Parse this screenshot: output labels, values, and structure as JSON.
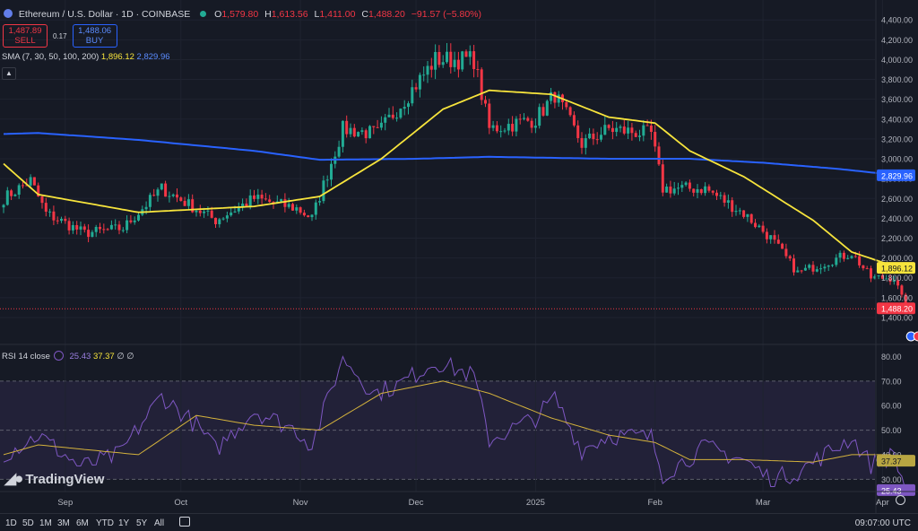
{
  "header": {
    "symbol": "Ethereum / U.S. Dollar · 1D · COINBASE",
    "o_label": "O",
    "o_value": "1,579.80",
    "h_label": "H",
    "h_value": "1,613.56",
    "l_label": "L",
    "l_value": "1,411.00",
    "c_label": "C",
    "c_value": "1,488.20",
    "change": "−91.57 (−5.80%)"
  },
  "trade": {
    "sell_price": "1,487.89",
    "sell_label": "SELL",
    "spread": "0.17",
    "buy_price": "1,488.06",
    "buy_label": "BUY"
  },
  "sma_legend": {
    "label": "SMA (7, 30, 50, 100, 200)",
    "v1": "1,896.12",
    "v2": "2,829.96"
  },
  "rsi_legend": {
    "label": "RSI 14 close",
    "v1": "25.43",
    "v2": "37.37",
    "v3": "∅",
    "v4": "∅"
  },
  "branding": {
    "logo_text": "TradingView"
  },
  "bottom_bar": {
    "timeframes": [
      "1D",
      "5D",
      "1M",
      "3M",
      "6M",
      "YTD",
      "1Y",
      "5Y",
      "All"
    ],
    "clock": "09:07:00 UTC"
  },
  "colors": {
    "background": "#161a25",
    "up": "#22ab94",
    "down": "#f23645",
    "sma_fast": "#f7e43c",
    "sma_slow": "#2962ff",
    "rsi": "#7e57c2",
    "rsi_ma": "#d4b23c"
  },
  "chart_data": [
    {
      "type": "candlestick",
      "title": "Ethereum / U.S. Dollar · 1D · COINBASE",
      "x_labels": [
        "Sep",
        "Oct",
        "Nov",
        "Dec",
        "2025",
        "Feb",
        "Mar",
        "Apr"
      ],
      "y_ticks": [
        "1,400.00",
        "1,600.00",
        "1,800.00",
        "2,000.00",
        "2,200.00",
        "2,400.00",
        "2,600.00",
        "2,800.00",
        "3,000.00",
        "3,200.00",
        "3,400.00",
        "3,600.00",
        "3,800.00",
        "4,000.00",
        "4,200.00",
        "4,400.00"
      ],
      "ylim": [
        1300,
        4420
      ],
      "close_anchors": [
        [
          "2024-08-16",
          2600
        ],
        [
          "2024-08-23",
          2780
        ],
        [
          "2024-08-27",
          2450
        ],
        [
          "2024-09-06",
          2250
        ],
        [
          "2024-09-16",
          2300
        ],
        [
          "2024-09-26",
          2700
        ],
        [
          "2024-10-10",
          2380
        ],
        [
          "2024-10-20",
          2600
        ],
        [
          "2024-10-31",
          2500
        ],
        [
          "2024-11-04",
          2400
        ],
        [
          "2024-11-12",
          3300
        ],
        [
          "2024-11-21",
          3250
        ],
        [
          "2024-11-26",
          3500
        ],
        [
          "2024-12-06",
          4000
        ],
        [
          "2024-12-16",
          4000
        ],
        [
          "2024-12-20",
          3300
        ],
        [
          "2025-01-01",
          3400
        ],
        [
          "2025-01-06",
          3650
        ],
        [
          "2025-01-13",
          3150
        ],
        [
          "2025-01-20",
          3300
        ],
        [
          "2025-01-31",
          3250
        ],
        [
          "2025-02-03",
          2700
        ],
        [
          "2025-02-14",
          2700
        ],
        [
          "2025-02-24",
          2450
        ],
        [
          "2025-03-03",
          2200
        ],
        [
          "2025-03-10",
          1850
        ],
        [
          "2025-03-24",
          2050
        ],
        [
          "2025-03-29",
          1800
        ],
        [
          "2025-04-04",
          1800
        ],
        [
          "2025-04-07",
          1488.2
        ]
      ],
      "sma_7": [
        [
          "2024-08-16",
          2950
        ],
        [
          "2024-08-25",
          2640
        ],
        [
          "2024-09-20",
          2460
        ],
        [
          "2024-10-05",
          2490
        ],
        [
          "2024-10-20",
          2520
        ],
        [
          "2024-11-06",
          2620
        ],
        [
          "2024-11-22",
          3000
        ],
        [
          "2024-12-08",
          3500
        ],
        [
          "2024-12-20",
          3690
        ],
        [
          "2025-01-05",
          3650
        ],
        [
          "2025-01-20",
          3420
        ],
        [
          "2025-02-01",
          3360
        ],
        [
          "2025-02-10",
          3080
        ],
        [
          "2025-02-24",
          2820
        ],
        [
          "2025-03-14",
          2380
        ],
        [
          "2025-03-24",
          2060
        ],
        [
          "2025-04-03",
          1930
        ],
        [
          "2025-04-06",
          1896.12
        ]
      ],
      "sma_200": [
        [
          "2024-08-16",
          3250
        ],
        [
          "2024-08-25",
          3260
        ],
        [
          "2024-09-20",
          3190
        ],
        [
          "2024-10-20",
          3080
        ],
        [
          "2024-11-06",
          2990
        ],
        [
          "2024-12-01",
          3000
        ],
        [
          "2024-12-20",
          3020
        ],
        [
          "2025-01-20",
          3000
        ],
        [
          "2025-02-10",
          3000
        ],
        [
          "2025-03-01",
          2960
        ],
        [
          "2025-03-20",
          2900
        ],
        [
          "2025-04-06",
          2829.96
        ]
      ],
      "last_price": 1488.2,
      "sma_7_last": 1896.12,
      "sma_200_last": 2829.96
    },
    {
      "type": "line",
      "title": "RSI 14 close",
      "y_ticks": [
        "30.00",
        "40.00",
        "50.00",
        "60.00",
        "70.00",
        "80.00"
      ],
      "levels": [
        70,
        50,
        30
      ],
      "ylim": [
        25,
        82
      ],
      "rsi_anchors": [
        [
          "2024-08-16",
          40
        ],
        [
          "2024-08-25",
          48
        ],
        [
          "2024-09-05",
          35
        ],
        [
          "2024-09-15",
          40
        ],
        [
          "2024-09-26",
          64
        ],
        [
          "2024-10-05",
          52
        ],
        [
          "2024-10-10",
          42
        ],
        [
          "2024-10-20",
          58
        ],
        [
          "2024-10-31",
          50
        ],
        [
          "2024-11-04",
          44
        ],
        [
          "2024-11-12",
          80
        ],
        [
          "2024-11-20",
          65
        ],
        [
          "2024-11-26",
          68
        ],
        [
          "2024-12-06",
          78
        ],
        [
          "2024-12-16",
          72
        ],
        [
          "2024-12-20",
          46
        ],
        [
          "2025-01-01",
          55
        ],
        [
          "2025-01-06",
          63
        ],
        [
          "2025-01-13",
          42
        ],
        [
          "2025-01-20",
          48
        ],
        [
          "2025-01-31",
          47
        ],
        [
          "2025-02-03",
          32
        ],
        [
          "2025-02-14",
          43
        ],
        [
          "2025-02-24",
          38
        ],
        [
          "2025-03-03",
          30
        ],
        [
          "2025-03-10",
          33
        ],
        [
          "2025-03-24",
          47
        ],
        [
          "2025-03-29",
          36
        ],
        [
          "2025-04-04",
          40
        ],
        [
          "2025-04-07",
          25.43
        ]
      ],
      "rsi_ma_anchors": [
        [
          "2024-08-16",
          40
        ],
        [
          "2024-08-25",
          44
        ],
        [
          "2024-09-20",
          40
        ],
        [
          "2024-10-05",
          56
        ],
        [
          "2024-10-20",
          52
        ],
        [
          "2024-11-06",
          50
        ],
        [
          "2024-11-22",
          65
        ],
        [
          "2024-12-08",
          70
        ],
        [
          "2024-12-20",
          65
        ],
        [
          "2025-01-05",
          55
        ],
        [
          "2025-01-20",
          48
        ],
        [
          "2025-02-01",
          45
        ],
        [
          "2025-02-10",
          38
        ],
        [
          "2025-02-24",
          38
        ],
        [
          "2025-03-14",
          37
        ],
        [
          "2025-03-24",
          40
        ],
        [
          "2025-04-03",
          40
        ],
        [
          "2025-04-06",
          37.37
        ]
      ],
      "rsi_last": 25.43,
      "rsi_ma_last": 37.37
    }
  ]
}
